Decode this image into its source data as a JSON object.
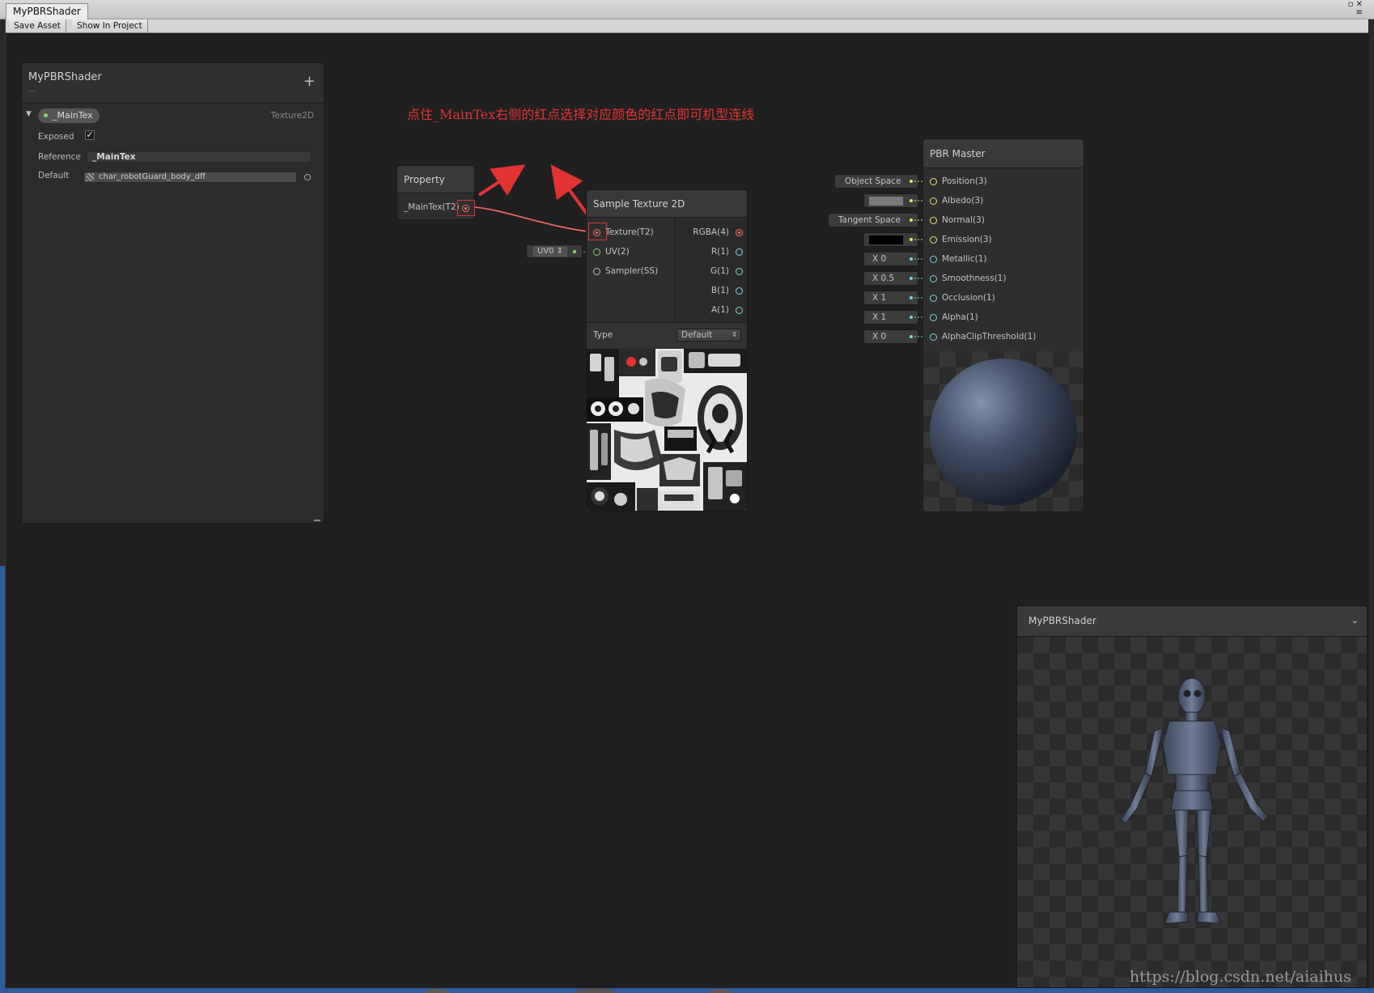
{
  "window": {
    "tab_title": "MyPBRShader"
  },
  "toolbar": {
    "save_asset": "Save Asset",
    "show_in_project": "Show In Project"
  },
  "blackboard": {
    "title": "MyPBRShader",
    "subtitle": "—",
    "add_label": "+",
    "property": {
      "name": "_MainTex",
      "type": "Texture2D",
      "exposed_label": "Exposed",
      "exposed": true,
      "reference_label": "Reference",
      "reference_value": "_MainTex",
      "default_label": "Default",
      "default_value": "char_robotGuard_body_dff"
    }
  },
  "annotation": "点住_MainTex右侧的红点选择对应颜色的红点即可机型连线",
  "property_node": {
    "title": "Property",
    "output": "_MainTex(T2)"
  },
  "sample_texture": {
    "title": "Sample Texture 2D",
    "inputs": [
      "Texture(T2)",
      "UV(2)",
      "Sampler(SS)"
    ],
    "outputs": [
      "RGBA(4)",
      "R(1)",
      "G(1)",
      "B(1)",
      "A(1)"
    ],
    "type_label": "Type",
    "type_value": "Default",
    "uv_stub": "UV0"
  },
  "pbr_master": {
    "title": "PBR Master",
    "inputs": [
      "Position(3)",
      "Albedo(3)",
      "Normal(3)",
      "Emission(3)",
      "Metallic(1)",
      "Smoothness(1)",
      "Occlusion(1)",
      "Alpha(1)",
      "AlphaClipThreshold(1)"
    ],
    "stubs": {
      "position": "Object Space",
      "normal": "Tangent Space",
      "metallic": "X 0",
      "smoothness": "X 0.5",
      "occlusion": "X 1",
      "alpha": "X 1",
      "alpha_clip": "X 0"
    },
    "albedo_color": "#7a7a7a",
    "emission_color": "#000000"
  },
  "main_preview": {
    "title": "MyPBRShader",
    "chevron": "⌄"
  },
  "watermark": "https://blog.csdn.net/aiaihus",
  "colors": {
    "accent_red": "#e23333",
    "texture_port": "#ff6b6b",
    "uv_port": "#8fd16c",
    "vector_port": "#f0e36a",
    "float_port": "#7cd3e0"
  }
}
